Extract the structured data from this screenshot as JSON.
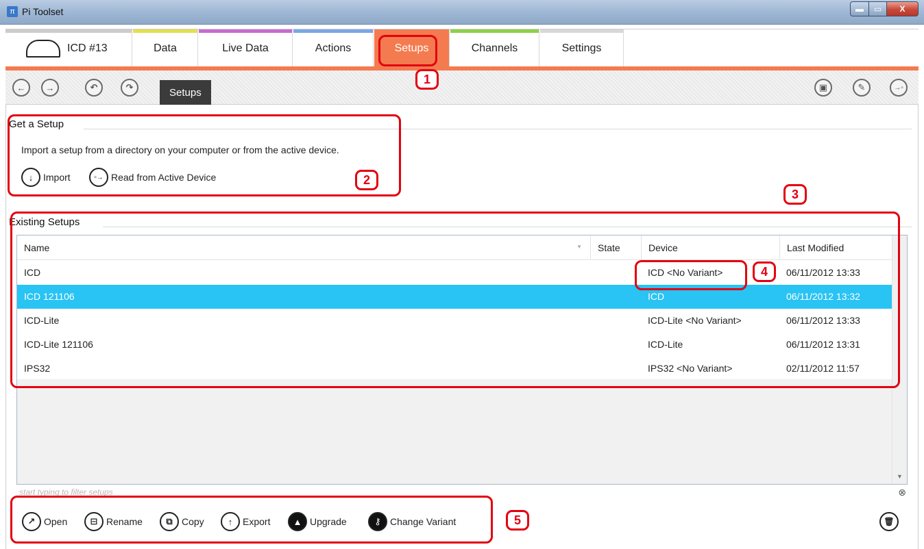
{
  "window": {
    "title": "Pi Toolset",
    "min_glyph": "▬",
    "max_glyph": "▭",
    "close_glyph": "X"
  },
  "tabs": [
    {
      "label": "ICD #13",
      "stripe": "#cccccc"
    },
    {
      "label": "Data",
      "stripe": "#e3e04d"
    },
    {
      "label": "Live Data",
      "stripe": "#c66bd1"
    },
    {
      "label": "Actions",
      "stripe": "#7aa6e8"
    },
    {
      "label": "Setups",
      "stripe": "#f47b4f",
      "active": true
    },
    {
      "label": "Channels",
      "stripe": "#8fd14a"
    },
    {
      "label": "Settings",
      "stripe": "#d8d8d8"
    }
  ],
  "toolbar": {
    "back_glyph": "←",
    "forward_glyph": "→",
    "undo_glyph": "↶",
    "redo_glyph": "↷",
    "breadcrumb": "Setups",
    "save_glyph": "▣",
    "save_as_glyph": "✎",
    "send_glyph": "→▫"
  },
  "get_setup": {
    "title": "Get a Setup",
    "description": "Import a setup from a directory on your computer or from the active device.",
    "import_label": "Import",
    "import_glyph": "↓",
    "read_label": "Read from Active Device",
    "read_glyph": "▫→"
  },
  "existing": {
    "title": "Existing Setups",
    "columns": {
      "name": "Name",
      "state": "State",
      "device": "Device",
      "modified": "Last Modified"
    },
    "sort_glyph": "▼",
    "rows": [
      {
        "name": "ICD",
        "state": "",
        "device": "ICD <No Variant>",
        "modified": "06/11/2012 13:33"
      },
      {
        "name": "ICD 121106",
        "state": "",
        "device": "ICD",
        "modified": "06/11/2012 13:32",
        "selected": true
      },
      {
        "name": "ICD-Lite",
        "state": "",
        "device": "ICD-Lite <No Variant>",
        "modified": "06/11/2012 13:33"
      },
      {
        "name": "ICD-Lite 121106",
        "state": "",
        "device": "ICD-Lite",
        "modified": "06/11/2012 13:31"
      },
      {
        "name": "IPS32",
        "state": "",
        "device": "IPS32 <No Variant>",
        "modified": "02/11/2012 11:57"
      }
    ],
    "scroll_down_glyph": "▼",
    "filter_placeholder": "start typing to filter setups",
    "filter_clear_glyph": "⊗"
  },
  "actions": {
    "open": "Open",
    "open_glyph": "↗",
    "rename": "Rename",
    "rename_glyph": "⊟",
    "copy": "Copy",
    "copy_glyph": "⧉",
    "export": "Export",
    "export_glyph": "↑",
    "upgrade": "Upgrade",
    "upgrade_glyph": "▲",
    "change_variant": "Change Variant",
    "change_variant_glyph": "⚷",
    "delete_glyph": "🗑"
  },
  "callouts": [
    "1",
    "2",
    "3",
    "4",
    "5"
  ],
  "colors": {
    "accent": "#f47b4f",
    "selection": "#29c3f4",
    "callout": "#e3000f"
  }
}
